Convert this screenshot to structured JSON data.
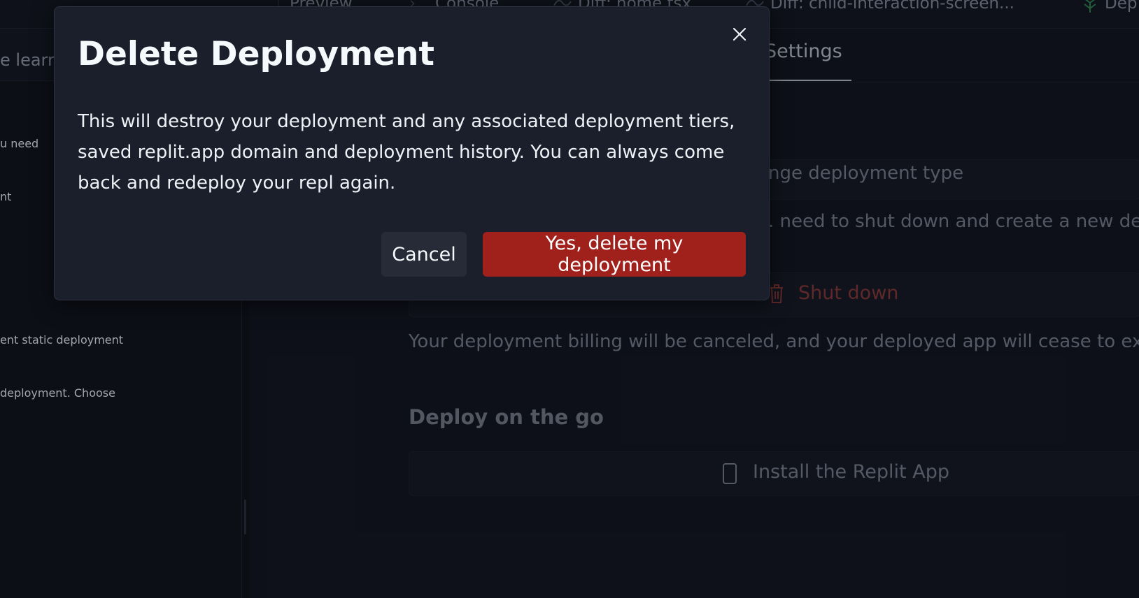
{
  "topbar": {
    "tabs": [
      {
        "label": "Preview"
      },
      {
        "label": "Console"
      },
      {
        "label": "Diff: home.tsx"
      },
      {
        "label": "Diff: child-interaction-screen..."
      },
      {
        "label": "Dep"
      }
    ]
  },
  "left": {
    "header_fragment": "e learni",
    "lines": [
      "u need",
      "nt",
      "ent static deployment",
      " deployment. Choose"
    ]
  },
  "right": {
    "settings_tab": "Settings",
    "change_type_label": "nge deployment type",
    "change_type_desc": ". need to shut down and create a new depl",
    "shutdown_label": "Shut down",
    "shutdown_desc": "Your deployment billing will be canceled, and your deployed app will cease to exist",
    "deploy_go_heading": "Deploy on the go",
    "install_app_label": "Install the Replit App"
  },
  "modal": {
    "title": "Delete Deployment",
    "body": "This will destroy your deployment and any associated deployment tiers, saved replit.app domain and deployment history. You can always come back and redeploy your repl again.",
    "cancel_label": "Cancel",
    "confirm_label": "Yes, delete my deployment"
  },
  "colors": {
    "confirm_bg": "#a0201b",
    "modal_bg": "#1b1f2b",
    "page_bg": "#0e1117"
  },
  "icons": [
    "close-icon",
    "trash-icon",
    "phone-icon",
    "deploy-icon",
    "diff-icon"
  ]
}
